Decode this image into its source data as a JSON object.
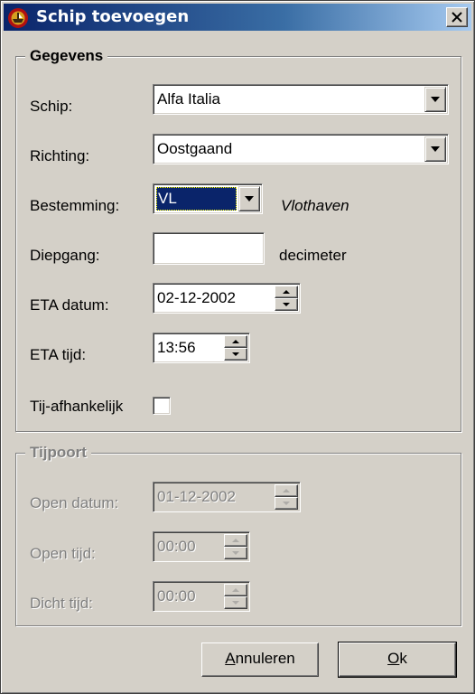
{
  "window": {
    "title": "Schip toevoegen"
  },
  "gegevens": {
    "legend": "Gegevens",
    "schip": {
      "label": "Schip:",
      "value": "Alfa Italia"
    },
    "richting": {
      "label": "Richting:",
      "value": "Oostgaand"
    },
    "bestemming": {
      "label": "Bestemming:",
      "value": "VL",
      "description": "Vlothaven"
    },
    "diepgang": {
      "label": "Diepgang:",
      "value": "",
      "unit": "decimeter"
    },
    "eta_datum": {
      "label": "ETA datum:",
      "value": "02-12-2002"
    },
    "eta_tijd": {
      "label": "ETA tijd:",
      "value": "13:56"
    },
    "tij_afhankelijk": {
      "label": "Tij-afhankelijk",
      "checked": false
    }
  },
  "tijpoort": {
    "legend": "Tijpoort",
    "open_datum": {
      "label": "Open datum:",
      "value": "01-12-2002"
    },
    "open_tijd": {
      "label": "Open tijd:",
      "value": "00:00"
    },
    "dicht_tijd": {
      "label": "Dicht tijd:",
      "value": "00:00"
    }
  },
  "buttons": {
    "annuleren": {
      "mnemonic": "A",
      "rest": "nnuleren"
    },
    "ok": {
      "mnemonic": "O",
      "rest": "k"
    }
  },
  "icons": {
    "app": "ship-emblem-icon",
    "close": "close-icon",
    "dropdown": "chevron-down-icon",
    "spin_up": "spin-up-icon",
    "spin_down": "spin-down-icon"
  },
  "colors": {
    "face": "#d4d0c8",
    "title_start": "#0a246a",
    "title_end": "#a6caf0",
    "selection": "#0a246a",
    "disabled_text": "#808080"
  }
}
